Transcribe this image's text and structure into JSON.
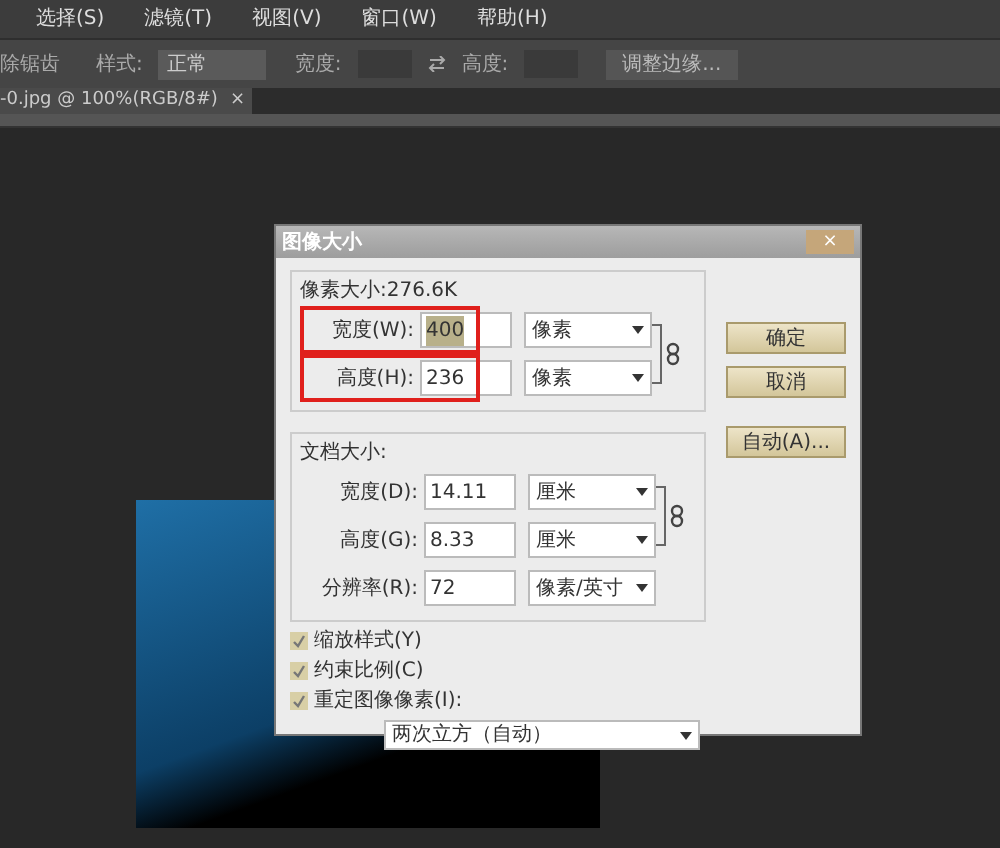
{
  "menu_bar": [
    "选择(S)",
    "滤镜(T)",
    "视图(V)",
    "窗口(W)",
    "帮助(H)"
  ],
  "options_bar": {
    "antialias": "除锯齿",
    "style_label": "样式:",
    "style_value": "正常",
    "width_label": "宽度:",
    "height_label": "高度:",
    "refine_button": "调整边缘..."
  },
  "document_tab": {
    "title": "-0.jpg @ 100%(RGB/8#)",
    "close": "×"
  },
  "dialog": {
    "title": "图像大小",
    "close": "×",
    "pixel_dimensions": {
      "label": "像素大小:276.6K",
      "rows": [
        {
          "label": "宽度(W):",
          "value": "400",
          "unit": "像素",
          "selected": true
        },
        {
          "label": "高度(H):",
          "value": "236",
          "unit": "像素",
          "selected": false
        }
      ]
    },
    "document_size": {
      "label": "文档大小:",
      "rows": [
        {
          "label": "宽度(D):",
          "value": "14.11",
          "unit": "厘米"
        },
        {
          "label": "高度(G):",
          "value": "8.33",
          "unit": "厘米"
        },
        {
          "label": "分辨率(R):",
          "value": "72",
          "unit": "像素/英寸"
        }
      ]
    },
    "checkboxes": [
      {
        "label": "缩放样式(Y)",
        "checked": true
      },
      {
        "label": "约束比例(C)",
        "checked": true
      },
      {
        "label": "重定图像像素(I):",
        "checked": true
      }
    ],
    "resample": "两次立方（自动）",
    "buttons": [
      "确定",
      "取消",
      "自动(A)..."
    ]
  }
}
